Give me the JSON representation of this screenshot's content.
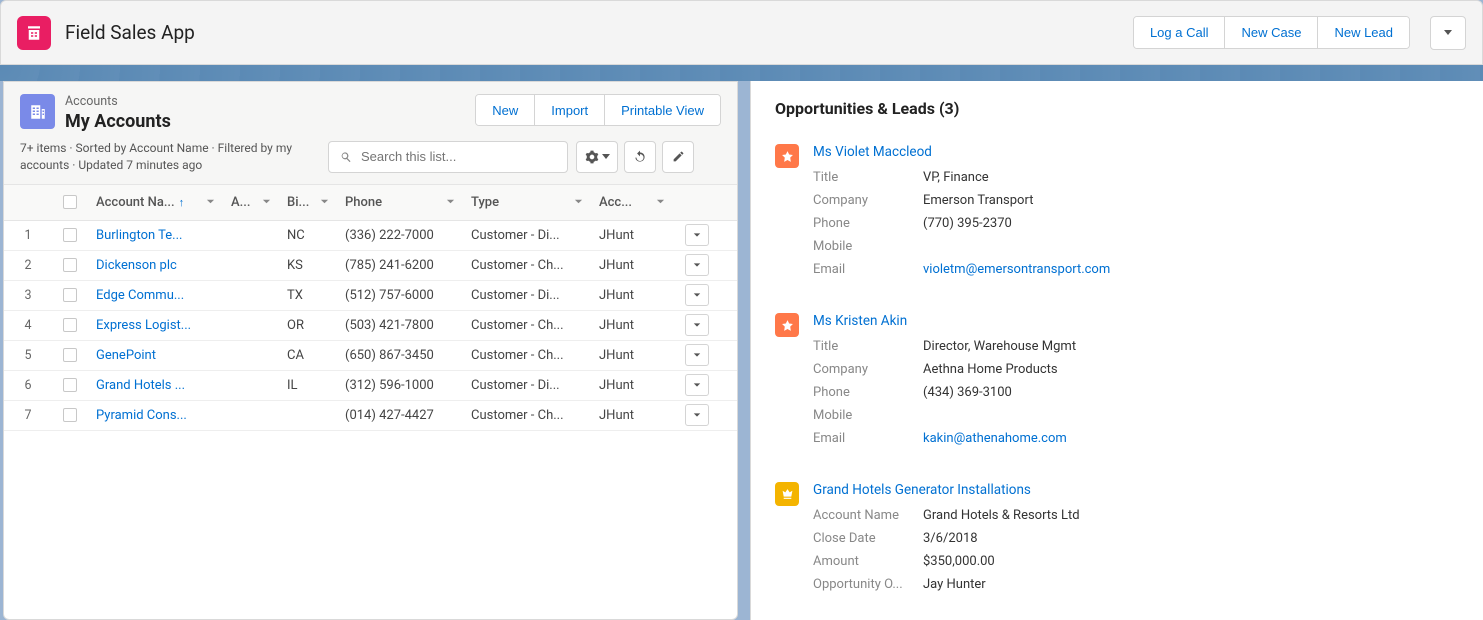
{
  "app": {
    "name": "Field Sales App"
  },
  "topButtons": {
    "logCall": "Log a Call",
    "newCase": "New Case",
    "newLead": "New Lead"
  },
  "leftCard": {
    "objectLabel": "Accounts",
    "listName": "My Accounts",
    "buttons": {
      "new": "New",
      "import": "Import",
      "printable": "Printable View"
    },
    "meta": "7+ items · Sorted by Account Name · Filtered by my accounts · Updated 7 minutes ago",
    "searchPlaceholder": "Search this list..."
  },
  "columns": {
    "name": "Account Na...",
    "a": "A...",
    "bi": "Bi...",
    "phone": "Phone",
    "type": "Type",
    "acc": "Acc..."
  },
  "rows": [
    {
      "num": "1",
      "name": "Burlington Te...",
      "bi": "NC",
      "phone": "(336) 222-7000",
      "type": "Customer - Di...",
      "acc": "JHunt"
    },
    {
      "num": "2",
      "name": "Dickenson plc",
      "bi": "KS",
      "phone": "(785) 241-6200",
      "type": "Customer - Ch...",
      "acc": "JHunt"
    },
    {
      "num": "3",
      "name": "Edge Commu...",
      "bi": "TX",
      "phone": "(512) 757-6000",
      "type": "Customer - Di...",
      "acc": "JHunt"
    },
    {
      "num": "4",
      "name": "Express Logist...",
      "bi": "OR",
      "phone": "(503) 421-7800",
      "type": "Customer - Ch...",
      "acc": "JHunt"
    },
    {
      "num": "5",
      "name": "GenePoint",
      "bi": "CA",
      "phone": "(650) 867-3450",
      "type": "Customer - Ch...",
      "acc": "JHunt"
    },
    {
      "num": "6",
      "name": "Grand Hotels ...",
      "bi": "IL",
      "phone": "(312) 596-1000",
      "type": "Customer - Di...",
      "acc": "JHunt"
    },
    {
      "num": "7",
      "name": "Pyramid Cons...",
      "bi": "",
      "phone": "(014) 427-4427",
      "type": "Customer - Ch...",
      "acc": "JHunt"
    }
  ],
  "rightPanel": {
    "title": "Opportunities & Leads (3)",
    "items": [
      {
        "kind": "lead",
        "name": "Ms Violet Maccleod",
        "fields": [
          {
            "label": "Title",
            "value": "VP, Finance"
          },
          {
            "label": "Company",
            "value": "Emerson Transport"
          },
          {
            "label": "Phone",
            "value": "(770) 395-2370"
          },
          {
            "label": "Mobile",
            "value": ""
          },
          {
            "label": "Email",
            "value": "violetm@emersontransport.com",
            "link": true
          }
        ]
      },
      {
        "kind": "lead",
        "name": "Ms Kristen Akin",
        "fields": [
          {
            "label": "Title",
            "value": "Director, Warehouse Mgmt"
          },
          {
            "label": "Company",
            "value": "Aethna Home Products"
          },
          {
            "label": "Phone",
            "value": "(434) 369-3100"
          },
          {
            "label": "Mobile",
            "value": ""
          },
          {
            "label": "Email",
            "value": "kakin@athenahome.com",
            "link": true
          }
        ]
      },
      {
        "kind": "opportunity",
        "name": "Grand Hotels Generator Installations",
        "fields": [
          {
            "label": "Account Name",
            "value": "Grand Hotels & Resorts Ltd"
          },
          {
            "label": "Close Date",
            "value": "3/6/2018"
          },
          {
            "label": "Amount",
            "value": "$350,000.00"
          },
          {
            "label": "Opportunity O...",
            "value": "Jay Hunter"
          }
        ]
      }
    ]
  }
}
